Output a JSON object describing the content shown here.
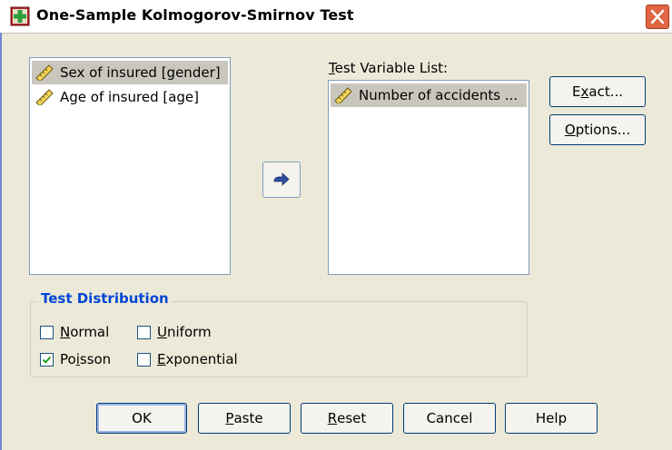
{
  "window": {
    "title": "One-Sample Kolmogorov-Smirnov Test",
    "close_icon": "close-x-icon",
    "app_icon": "spss-dialog-icon"
  },
  "source_list": {
    "items": [
      {
        "label": "Sex of insured [gender]",
        "icon": "scale-ruler-icon",
        "selected": true
      },
      {
        "label": "Age of insured [age]",
        "icon": "scale-ruler-icon",
        "selected": false
      }
    ]
  },
  "move_button": {
    "icon": "arrow-right-icon"
  },
  "test_variable_list": {
    "label_prefix": "",
    "label_mnemonic": "T",
    "label_rest": "est Variable List:",
    "items": [
      {
        "label": "Number of accidents ...",
        "icon": "scale-ruler-icon",
        "selected": true
      }
    ]
  },
  "side_buttons": {
    "exact": {
      "pre": "E",
      "mnemonic": "x",
      "post": "act..."
    },
    "options": {
      "pre": "",
      "mnemonic": "O",
      "post": "ptions..."
    }
  },
  "test_distribution": {
    "legend": "Test Distribution",
    "normal": {
      "pre": "",
      "mnemonic": "N",
      "post": "ormal",
      "checked": false
    },
    "uniform": {
      "pre": "",
      "mnemonic": "U",
      "post": "niform",
      "checked": false
    },
    "poisson": {
      "pre": "Po",
      "mnemonic": "i",
      "post": "sson",
      "checked": true
    },
    "exponential": {
      "pre": "",
      "mnemonic": "E",
      "post": "xponential",
      "checked": false
    }
  },
  "footer_buttons": {
    "ok": "OK",
    "paste": {
      "pre": "",
      "mnemonic": "P",
      "post": "aste"
    },
    "reset": {
      "pre": "",
      "mnemonic": "R",
      "post": "eset"
    },
    "cancel": "Cancel",
    "help": "Help"
  },
  "colors": {
    "dialog_bg": "#ece9d8",
    "legend_blue": "#0046d5",
    "selection_gray": "#c9c7bd",
    "close_red": "#e06744"
  }
}
